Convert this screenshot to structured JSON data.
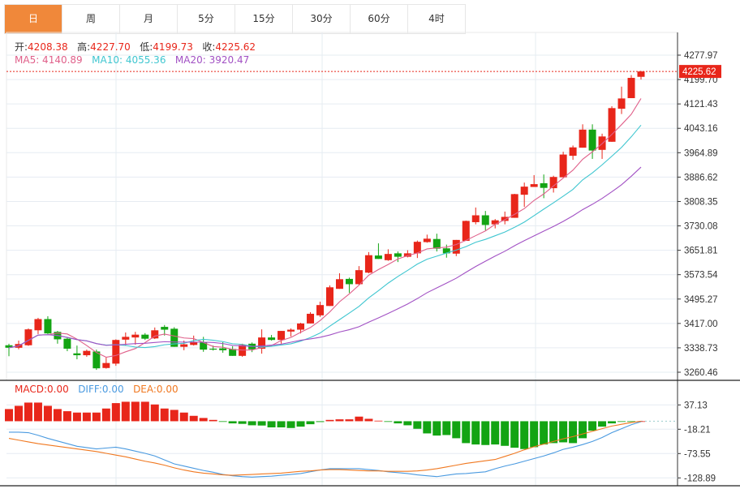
{
  "tabs": [
    {
      "label": "日",
      "active": true
    },
    {
      "label": "周"
    },
    {
      "label": "月"
    },
    {
      "label": "5分"
    },
    {
      "label": "15分"
    },
    {
      "label": "30分"
    },
    {
      "label": "60分"
    },
    {
      "label": "4时"
    }
  ],
  "ohlc_info": {
    "open_label": "开:",
    "open": "4208.38",
    "high_label": "高:",
    "high": "4227.70",
    "low_label": "低:",
    "low": "4199.73",
    "close_label": "收:",
    "close": "4225.62"
  },
  "ma_info": {
    "ma5": "MA5: 4140.89",
    "ma10": "MA10: 4055.36",
    "ma20": "MA20: 3920.47"
  },
  "macd_info": {
    "macd": "MACD:0.00",
    "diff": "DIFF:0.00",
    "dea": "DEA:0.00"
  },
  "colors": {
    "up": "#e8261a",
    "down": "#13a413",
    "ma5": "#e0608a",
    "ma10": "#3fc6d0",
    "ma20": "#a251c4",
    "diff": "#4a9ae0",
    "dea": "#f07820",
    "active_tab": "#f0883a"
  },
  "chart_data": [
    {
      "type": "candlestick",
      "ylim": [
        3260.46,
        4277.97
      ],
      "y_ticks": [
        "4277.97",
        "4199.70",
        "4121.43",
        "4043.16",
        "3964.89",
        "3886.62",
        "3808.35",
        "3730.08",
        "3651.81",
        "3573.54",
        "3495.27",
        "3417.00",
        "3338.73",
        "3260.46"
      ],
      "last_price": "4225.62",
      "grid": true,
      "candles": [
        [
          3347,
          3339,
          3352,
          3312
        ],
        [
          3339,
          3351,
          3362,
          3334
        ],
        [
          3347,
          3398,
          3401,
          3345
        ],
        [
          3395,
          3431,
          3435,
          3383
        ],
        [
          3431,
          3385,
          3440,
          3383
        ],
        [
          3390,
          3366,
          3393,
          3352
        ],
        [
          3368,
          3336,
          3372,
          3328
        ],
        [
          3321,
          3315,
          3346,
          3302
        ],
        [
          3315,
          3329,
          3333,
          3310
        ],
        [
          3327,
          3273,
          3333,
          3268
        ],
        [
          3274,
          3290,
          3307,
          3272
        ],
        [
          3288,
          3364,
          3366,
          3281
        ],
        [
          3365,
          3374,
          3388,
          3346
        ],
        [
          3372,
          3381,
          3390,
          3349
        ],
        [
          3381,
          3368,
          3386,
          3364
        ],
        [
          3369,
          3395,
          3404,
          3367
        ],
        [
          3406,
          3397,
          3412,
          3378
        ],
        [
          3400,
          3342,
          3405,
          3342
        ],
        [
          3342,
          3350,
          3362,
          3331
        ],
        [
          3348,
          3357,
          3378,
          3346
        ],
        [
          3356,
          3333,
          3374,
          3326
        ],
        [
          3336,
          3333,
          3346,
          3330
        ],
        [
          3337,
          3331,
          3357,
          3323
        ],
        [
          3335,
          3313,
          3344,
          3313
        ],
        [
          3313,
          3348,
          3352,
          3310
        ],
        [
          3352,
          3334,
          3356,
          3325
        ],
        [
          3336,
          3372,
          3398,
          3320
        ],
        [
          3372,
          3364,
          3380,
          3362
        ],
        [
          3364,
          3393,
          3393,
          3352
        ],
        [
          3391,
          3397,
          3401,
          3375
        ],
        [
          3397,
          3417,
          3419,
          3385
        ],
        [
          3417,
          3448,
          3453,
          3417
        ],
        [
          3443,
          3476,
          3487,
          3438
        ],
        [
          3473,
          3533,
          3539,
          3473
        ],
        [
          3528,
          3559,
          3578,
          3528
        ],
        [
          3560,
          3543,
          3564,
          3515
        ],
        [
          3543,
          3588,
          3601,
          3541
        ],
        [
          3580,
          3636,
          3646,
          3578
        ],
        [
          3635,
          3624,
          3674,
          3624
        ],
        [
          3620,
          3640,
          3655,
          3618
        ],
        [
          3642,
          3631,
          3648,
          3614
        ],
        [
          3631,
          3642,
          3652,
          3629
        ],
        [
          3642,
          3679,
          3683,
          3627
        ],
        [
          3678,
          3689,
          3702,
          3676
        ],
        [
          3688,
          3657,
          3705,
          3648
        ],
        [
          3658,
          3642,
          3670,
          3628
        ],
        [
          3641,
          3685,
          3685,
          3633
        ],
        [
          3682,
          3746,
          3747,
          3682
        ],
        [
          3742,
          3764,
          3789,
          3735
        ],
        [
          3764,
          3733,
          3778,
          3716
        ],
        [
          3735,
          3748,
          3752,
          3722
        ],
        [
          3746,
          3759,
          3776,
          3735
        ],
        [
          3756,
          3832,
          3833,
          3756
        ],
        [
          3830,
          3856,
          3869,
          3791
        ],
        [
          3855,
          3864,
          3893,
          3855
        ],
        [
          3867,
          3852,
          3895,
          3819
        ],
        [
          3851,
          3887,
          3891,
          3837
        ],
        [
          3886,
          3959,
          3968,
          3886
        ],
        [
          3955,
          3982,
          3988,
          3942
        ],
        [
          3981,
          4039,
          4056,
          3981
        ],
        [
          4039,
          3972,
          4056,
          3945
        ],
        [
          3974,
          4017,
          4026,
          3945
        ],
        [
          4000,
          4108,
          4114,
          4000
        ],
        [
          4106,
          4139,
          4177,
          4089
        ],
        [
          4140,
          4205,
          4214,
          4140
        ],
        [
          4208.38,
          4225.62,
          4227.7,
          4199.73
        ]
      ]
    },
    {
      "type": "bar+line",
      "ylim": [
        -140,
        48
      ],
      "y_ticks": [
        "37.13",
        "-18.21",
        "-73.55",
        "-128.89"
      ],
      "macd": [
        27.7,
        35,
        42.4,
        42.4,
        35,
        27.7,
        22.8,
        19.7,
        19.7,
        19.7,
        28.9,
        41.2,
        44.3,
        44.3,
        44.3,
        38.1,
        28.9,
        25.8,
        19.7,
        12.3,
        7.4,
        3,
        -0.5,
        -4.9,
        -6,
        -9.2,
        -9.8,
        -14,
        -14,
        -15.4,
        -12.3,
        -6.8,
        -1.8,
        3,
        4.3,
        4.3,
        10.5,
        5.5,
        1.2,
        -1.2,
        -4.9,
        -9.2,
        -17.2,
        -27.7,
        -32.6,
        -31.4,
        -38.7,
        -49.8,
        -52.9,
        -54.1,
        -52.9,
        -56,
        -60.3,
        -63.3,
        -59,
        -52.9,
        -49.8,
        -48,
        -49.8,
        -38.7,
        -21.5,
        -12.3,
        -4.9,
        -1,
        -0.3,
        0
      ],
      "diff": [
        -25,
        -25,
        -26,
        -32,
        -39,
        -45,
        -51,
        -57,
        -60,
        -63,
        -61,
        -59,
        -63,
        -68,
        -73,
        -79,
        -88,
        -97,
        -102,
        -107,
        -112,
        -116,
        -121,
        -124,
        -126,
        -127,
        -126,
        -125,
        -123,
        -121,
        -119,
        -115,
        -111,
        -108,
        -108,
        -108,
        -108,
        -110,
        -112,
        -115,
        -117,
        -119,
        -122,
        -124,
        -126,
        -123,
        -120,
        -119,
        -117,
        -115,
        -108,
        -102,
        -97,
        -91,
        -85,
        -79,
        -72,
        -64,
        -59,
        -53,
        -46,
        -37,
        -26,
        -17,
        -8,
        -1
      ],
      "dea": [
        -39,
        -43,
        -47,
        -51,
        -54,
        -57,
        -60,
        -63,
        -66,
        -69,
        -73,
        -77,
        -81,
        -86,
        -91,
        -95,
        -100,
        -106,
        -111,
        -115,
        -118,
        -120,
        -122,
        -123,
        -122,
        -121,
        -120,
        -119,
        -118,
        -116,
        -114,
        -113,
        -111,
        -110,
        -110,
        -111,
        -112,
        -113,
        -113,
        -114,
        -114,
        -114,
        -113,
        -111,
        -108,
        -104,
        -100,
        -96,
        -93,
        -90,
        -87,
        -80,
        -73,
        -65,
        -58,
        -52,
        -46,
        -40,
        -35,
        -29,
        -23,
        -17,
        -11,
        -7,
        -3,
        0
      ]
    }
  ]
}
